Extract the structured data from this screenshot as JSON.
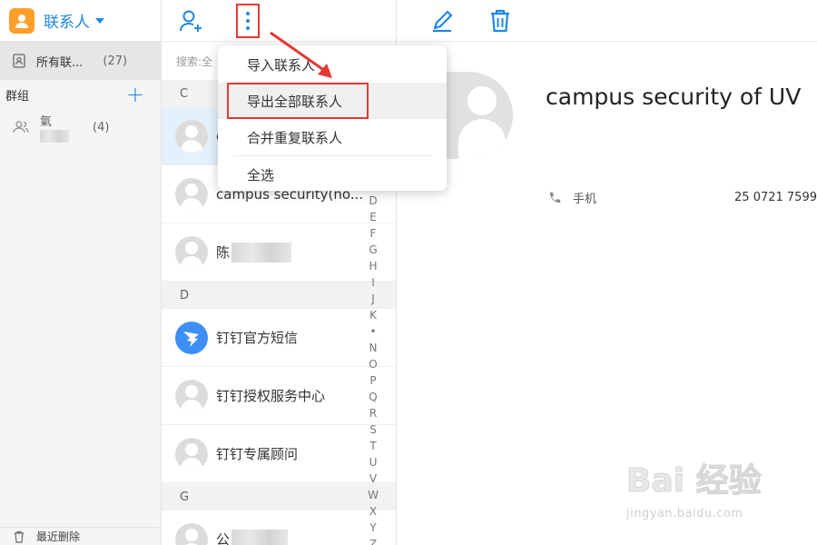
{
  "sidebar": {
    "app_title": "联系人",
    "all_contacts": {
      "label": "所有联...",
      "count": "(27)"
    },
    "groups_label": "群组",
    "add_group": "+",
    "group_item": {
      "name": "氣",
      "count": "(4)"
    },
    "footer_label": "最近删除"
  },
  "list": {
    "search_placeholder": "搜索:全",
    "sections": [
      "C",
      "D",
      "G"
    ],
    "contacts": [
      {
        "name": "c",
        "selected": true
      },
      {
        "name": "campus security(no..."
      },
      {
        "name": "陈"
      },
      {
        "name": "钉钉官方短信",
        "icon": "dingtalk-icon"
      },
      {
        "name": "钉钉授权服务中心"
      },
      {
        "name": "钉钉专属顾问"
      },
      {
        "name": "公"
      }
    ],
    "alphabet": [
      "D",
      "E",
      "F",
      "G",
      "H",
      "I",
      "J",
      "K",
      "•",
      "N",
      "O",
      "P",
      "Q",
      "R",
      "S",
      "T",
      "U",
      "V",
      "W",
      "X",
      "Y",
      "Z"
    ]
  },
  "menu": {
    "items": [
      "导入联系人",
      "导出全部联系人",
      "合并重复联系人",
      "全选"
    ]
  },
  "detail": {
    "name": "campus security of UV",
    "phone_label": "手机",
    "phone_number": "25 0721 7599"
  },
  "watermark": {
    "main": "Bai 经验",
    "sub": "jingyan.baidu.com"
  },
  "colors": {
    "accent": "#1e88e5",
    "annotation": "#e53935",
    "logo": "#ff9f2b",
    "selected_row": "#e4f0fb"
  }
}
